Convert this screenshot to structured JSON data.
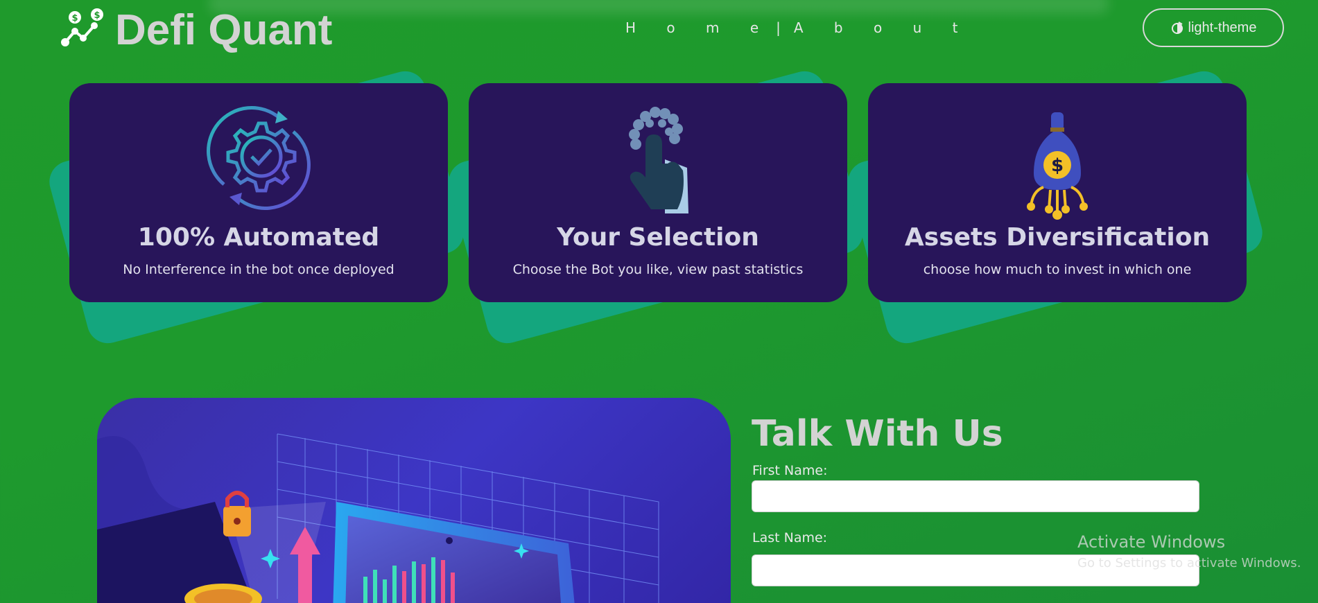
{
  "header": {
    "logo_text": "Defi Quant",
    "nav": {
      "home": "H o m e",
      "separator": "|",
      "about": "A b o u t"
    },
    "theme_button_label": "light-theme"
  },
  "cards": [
    {
      "icon": "automation-gear-icon",
      "title": "100% Automated",
      "description": "No Interference in the bot once deployed"
    },
    {
      "icon": "hand-pointer-icon",
      "title": "Your Selection",
      "description": "Choose the Bot you like, view past statistics"
    },
    {
      "icon": "money-bag-icon",
      "title": "Assets Diversification",
      "description": "choose how much to invest in which one"
    }
  ],
  "contact": {
    "title": "Talk With Us",
    "first_name_label": "First Name:",
    "first_name_value": "",
    "last_name_label": "Last Name:",
    "last_name_value": ""
  },
  "watermark": {
    "line1": "Activate Windows",
    "line2": "Go to Settings to activate Windows."
  },
  "colors": {
    "background": "#1f9a2c",
    "card": "#28155a",
    "card_back": "#14a67e",
    "hero": "#3a2fa6"
  }
}
